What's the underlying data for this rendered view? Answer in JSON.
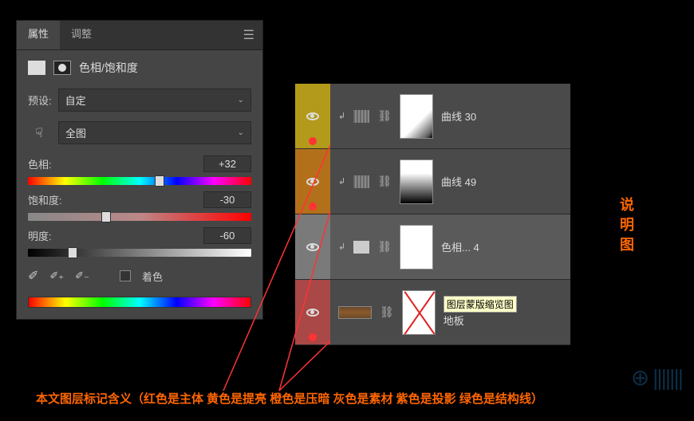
{
  "panel": {
    "tabs": {
      "properties": "属性",
      "adjustments": "调整"
    },
    "title": "色相/饱和度",
    "preset_label": "预设:",
    "preset_value": "自定",
    "range_value": "全图",
    "hue_label": "色相:",
    "hue_value": "+32",
    "sat_label": "饱和度:",
    "sat_value": "-30",
    "light_label": "明度:",
    "light_value": "-60",
    "colorize_label": "着色"
  },
  "layers": [
    {
      "color": "yellow",
      "name": "曲线 30",
      "thumb": "mask1",
      "dot": true
    },
    {
      "color": "orange",
      "name": "曲线 49",
      "thumb": "mask2",
      "dot": true
    },
    {
      "color": "gray",
      "name": "色相... 4",
      "thumb": "white",
      "selected": true
    },
    {
      "color": "red",
      "name": "地板",
      "thumb": "x",
      "tooltip": "图层蒙版缩览图",
      "dot": true,
      "wood": true
    }
  ],
  "side_text": [
    "说",
    "明",
    "图"
  ],
  "caption": "本文图层标记含义（红色是主体  黄色是提亮  橙色是压暗  灰色是素材   紫色是投影   绿色是结构线）"
}
